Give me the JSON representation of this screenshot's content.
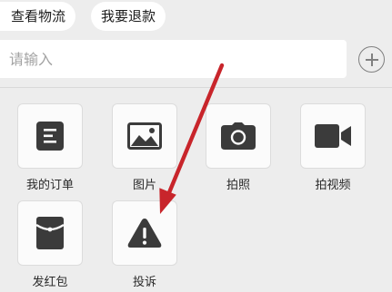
{
  "quick_actions": [
    {
      "label": "查看物流"
    },
    {
      "label": "我要退款"
    }
  ],
  "input": {
    "placeholder": "请输入",
    "value": ""
  },
  "add_button": {
    "icon": "plus-circle-icon"
  },
  "panel": {
    "items": [
      {
        "label": "我的订单",
        "icon": "order-list-icon"
      },
      {
        "label": "图片",
        "icon": "image-icon"
      },
      {
        "label": "拍照",
        "icon": "camera-icon"
      },
      {
        "label": "拍视频",
        "icon": "video-camera-icon"
      },
      {
        "label": "发红包",
        "icon": "red-packet-icon"
      },
      {
        "label": "投诉",
        "icon": "warning-icon"
      }
    ]
  },
  "annotation": {
    "color": "#c8252b",
    "icon": "arrow-annotation"
  },
  "colors": {
    "icon": "#3b3b3b",
    "background": "#ededed",
    "tile": "#fbfbfb"
  }
}
